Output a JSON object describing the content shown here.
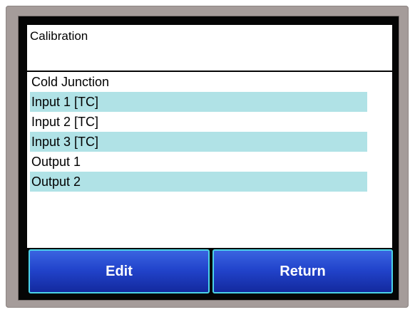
{
  "title": "Calibration",
  "list": {
    "items": [
      {
        "label": "Cold Junction"
      },
      {
        "label": "Input 1 [TC]"
      },
      {
        "label": "Input 2 [TC]"
      },
      {
        "label": "Input 3 [TC]"
      },
      {
        "label": "Output 1"
      },
      {
        "label": "Output 2"
      }
    ]
  },
  "buttons": {
    "edit_label": "Edit",
    "return_label": "Return"
  },
  "colors": {
    "bezel": "#a59c9a",
    "row_highlight": "#b0e2e6",
    "button_blue": "#2244cc",
    "button_border": "#4bd3e8"
  }
}
